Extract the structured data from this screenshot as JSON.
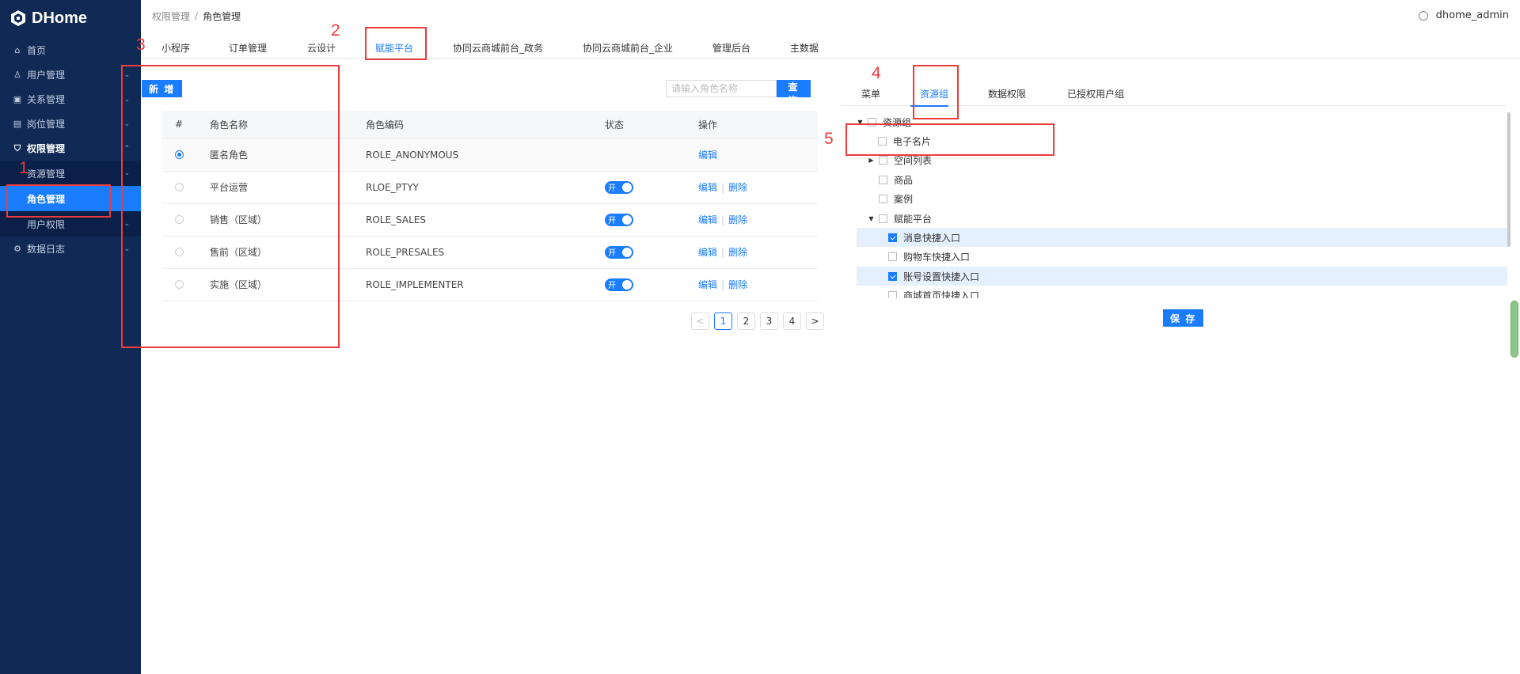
{
  "app": {
    "name": "DHome",
    "user": "dhome_admin",
    "accent": "#1a7cff",
    "sidebar_bg": "#102a55",
    "annotation_color": "#ee3b3b"
  },
  "breadcrumb": {
    "parent": "权限管理",
    "separator": "/",
    "current": "角色管理"
  },
  "sidebar": {
    "items": [
      {
        "label": "首页",
        "icon": "home-icon"
      },
      {
        "label": "用户管理",
        "icon": "user-icon"
      },
      {
        "label": "关系管理",
        "icon": "relation-icon"
      },
      {
        "label": "岗位管理",
        "icon": "briefcase-icon"
      },
      {
        "label": "权限管理",
        "icon": "shield-icon"
      },
      {
        "label": "数据日志",
        "icon": "log-icon"
      }
    ],
    "sub_items": [
      {
        "label": "资源管理"
      },
      {
        "label": "角色管理"
      },
      {
        "label": "用户权限"
      }
    ]
  },
  "tabs": [
    "小程序",
    "订单管理",
    "云设计",
    "赋能平台",
    "协同云商城前台_政务",
    "协同云商城前台_企业",
    "管理后台",
    "主数据"
  ],
  "toolbar": {
    "new_label": "新 增",
    "search_placeholder": "请输入角色名称",
    "search_label": "查 询"
  },
  "table": {
    "headers": [
      "#",
      "角色名称",
      "角色编码",
      "状态",
      "操作"
    ],
    "rows": [
      {
        "name": "匿名角色",
        "code": "ROLE_ANONYMOUS",
        "status": "",
        "edit": "编辑",
        "delete": ""
      },
      {
        "name": "平台运营",
        "code": "RLOE_PTYY",
        "status": "开",
        "edit": "编辑",
        "delete": "删除"
      },
      {
        "name": "销售（区域）",
        "code": "ROLE_SALES",
        "status": "开",
        "edit": "编辑",
        "delete": "删除"
      },
      {
        "name": "售前（区域）",
        "code": "ROLE_PRESALES",
        "status": "开",
        "edit": "编辑",
        "delete": "删除"
      },
      {
        "name": "实施（区域）",
        "code": "ROLE_IMPLEMENTER",
        "status": "开",
        "edit": "编辑",
        "delete": "删除"
      }
    ]
  },
  "pagination": {
    "pages": [
      "1",
      "2",
      "3",
      "4"
    ],
    "current": "1",
    "prev": "<",
    "next": ">"
  },
  "right_tabs": [
    "菜单",
    "资源组",
    "数据权限",
    "已授权用户组"
  ],
  "tree": {
    "nodes": [
      {
        "label": "资源组",
        "checked": false
      },
      {
        "label": "电子名片",
        "checked": false
      },
      {
        "label": "空间列表",
        "checked": false
      },
      {
        "label": "商品",
        "checked": false
      },
      {
        "label": "案例",
        "checked": false
      },
      {
        "label": "赋能平台",
        "checked": false
      },
      {
        "label": "消息快捷入口",
        "checked": true
      },
      {
        "label": "购物车快捷入口",
        "checked": false
      },
      {
        "label": "账号设置快捷入口",
        "checked": true
      },
      {
        "label": "商城首页快捷入口",
        "checked": false
      }
    ]
  },
  "save_label": "保 存",
  "annotations": [
    "1",
    "2",
    "3",
    "4",
    "5"
  ]
}
